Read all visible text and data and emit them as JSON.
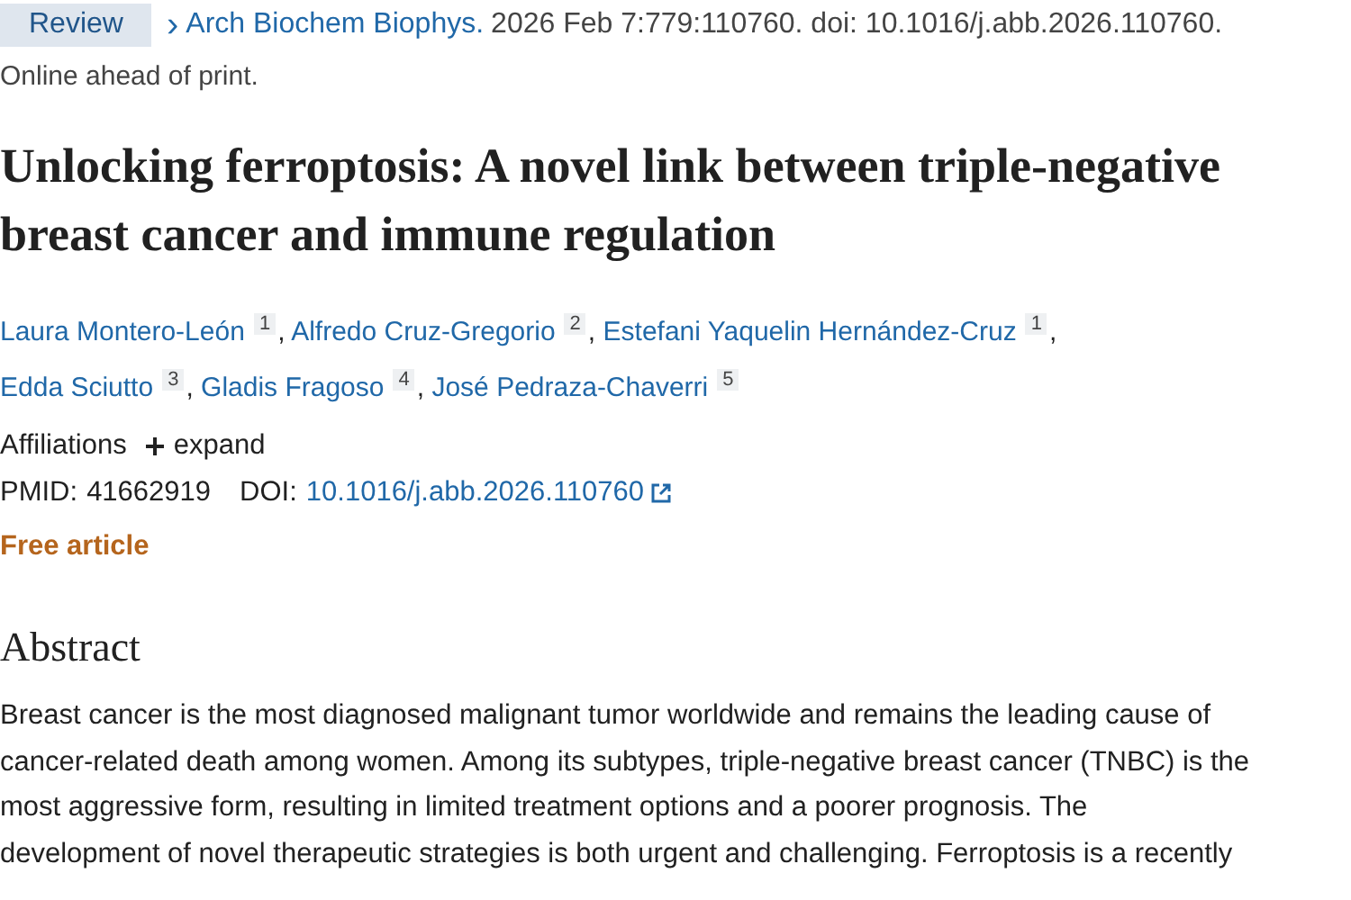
{
  "header": {
    "badge": "Review",
    "journal_icon": "›",
    "journal": "Arch Biochem Biophys.",
    "citation": "2026 Feb 7:779:110760. doi: 10.1016/j.abb.2026.110760.",
    "status": "Online ahead of print."
  },
  "title": "Unlocking ferroptosis: A novel link between triple-negative breast cancer and immune regulation",
  "authors": [
    {
      "name": "Laura Montero-León",
      "affiliation": "1",
      "suffix": ","
    },
    {
      "name": "Alfredo Cruz-Gregorio",
      "affiliation": "2",
      "suffix": ","
    },
    {
      "name": "Estefani Yaquelin Hernández-Cruz",
      "affiliation": "1",
      "suffix": ","
    },
    {
      "name": "Edda Sciutto",
      "affiliation": "3",
      "suffix": ","
    },
    {
      "name": "Gladis Fragoso",
      "affiliation": "4",
      "suffix": ","
    },
    {
      "name": "José Pedraza-Chaverri",
      "affiliation": "5"
    }
  ],
  "affiliations": {
    "label": "Affiliations",
    "toggle": "expand",
    "expanded": false
  },
  "identifiers": {
    "pmid_label": "PMID:",
    "pmid": "41662919",
    "doi_label": "DOI:",
    "doi": "10.1016/j.abb.2026.110760"
  },
  "free_article": "Free article",
  "abstract": {
    "heading": "Abstract",
    "lines": [
      "Breast cancer is the most diagnosed malignant tumor worldwide and remains the leading cause of",
      "cancer-related death among women. Among its subtypes, triple-negative breast cancer (TNBC) is the",
      "most aggressive form, resulting in limited treatment options and a poorer prognosis. The",
      "development of novel therapeutic strategies is both urgent and challenging. Ferroptosis is a recently"
    ]
  }
}
